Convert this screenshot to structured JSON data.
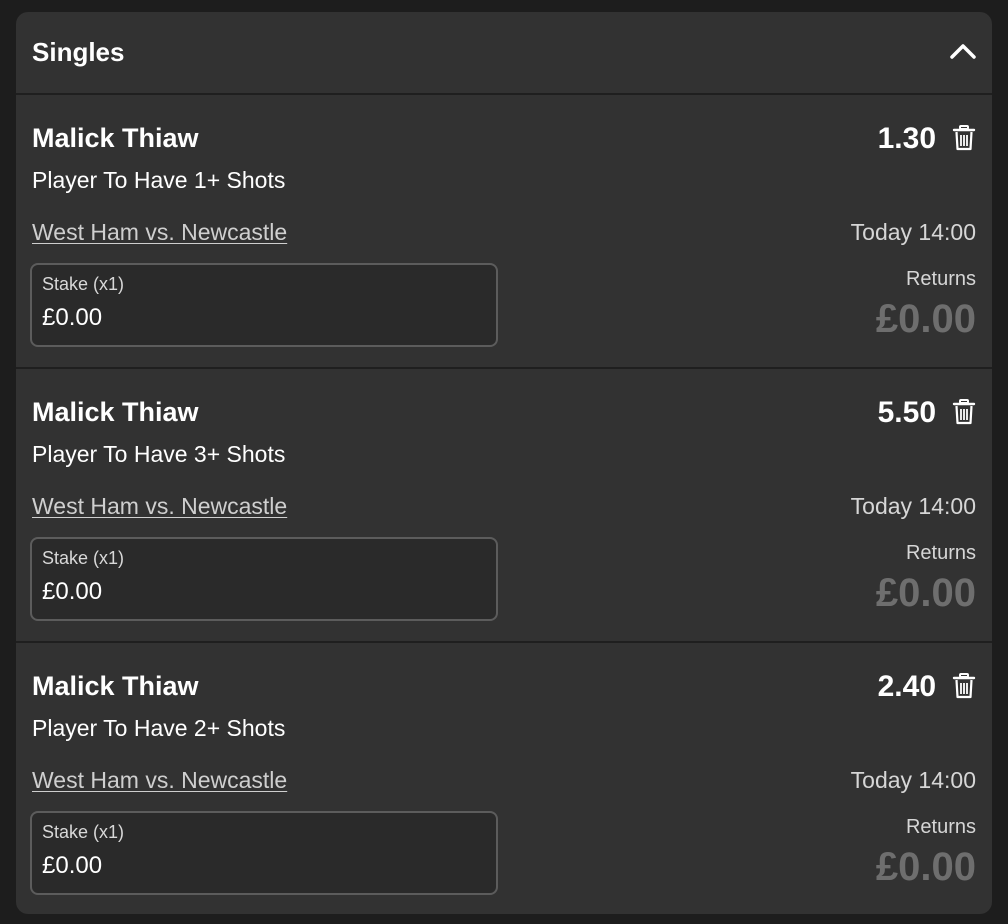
{
  "section": {
    "title": "Singles",
    "collapse_icon": "chevron-up-icon"
  },
  "bets": [
    {
      "player": "Malick Thiaw",
      "market": "Player To Have 1+ Shots",
      "event": "West Ham vs. Newcastle",
      "time": "Today 14:00",
      "odds": "1.30",
      "stake_label": "Stake (x1)",
      "stake_value": "£0.00",
      "returns_label": "Returns",
      "returns_value": "£0.00"
    },
    {
      "player": "Malick Thiaw",
      "market": "Player To Have 3+ Shots",
      "event": "West Ham vs. Newcastle",
      "time": "Today 14:00",
      "odds": "5.50",
      "stake_label": "Stake (x1)",
      "stake_value": "£0.00",
      "returns_label": "Returns",
      "returns_value": "£0.00"
    },
    {
      "player": "Malick Thiaw",
      "market": "Player To Have 2+ Shots",
      "event": "West Ham vs. Newcastle",
      "time": "Today 14:00",
      "odds": "2.40",
      "stake_label": "Stake (x1)",
      "stake_value": "£0.00",
      "returns_label": "Returns",
      "returns_value": "£0.00"
    }
  ],
  "colors": {
    "background": "#1d1d1d",
    "panel": "#323232",
    "input": "#2a2a2a",
    "returns_muted": "#6e6e6e"
  }
}
